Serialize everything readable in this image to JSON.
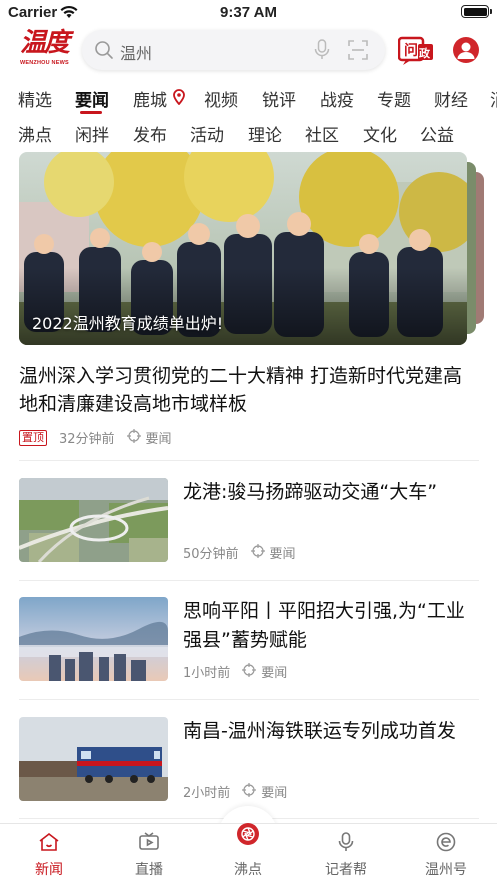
{
  "status_bar": {
    "carrier": "Carrier",
    "time": "9:37 AM",
    "battery_level": 1.0
  },
  "header": {
    "logo_text": "温度",
    "logo_subtext": "WENZHOU NEWS",
    "search_placeholder": "温州",
    "ask_label": "问政"
  },
  "channels_row1": [
    {
      "label": "精选",
      "active": false
    },
    {
      "label": "要闻",
      "active": true
    },
    {
      "label": "鹿城",
      "active": false
    },
    {
      "label": "视频",
      "active": false
    },
    {
      "label": "锐评",
      "active": false
    },
    {
      "label": "战疫",
      "active": false
    },
    {
      "label": "专题",
      "active": false
    },
    {
      "label": "财经",
      "active": false
    },
    {
      "label": "消",
      "active": false
    }
  ],
  "channels_row2": [
    {
      "label": "沸点"
    },
    {
      "label": "闲拌"
    },
    {
      "label": "发布"
    },
    {
      "label": "活动"
    },
    {
      "label": "理论"
    },
    {
      "label": "社区"
    },
    {
      "label": "文化"
    },
    {
      "label": "公益"
    }
  ],
  "hero": {
    "caption": "2022温州教育成绩单出炉!"
  },
  "top_article": {
    "title": "温州深入学习贯彻党的二十大精神 打造新时代党建高地和清廉建设高地市域样板",
    "badge": "置顶",
    "time": "32分钟前",
    "tag": "要闻"
  },
  "articles": [
    {
      "title": "龙港:骏马扬蹄驱动交通“大车”",
      "time": "50分钟前",
      "tag": "要闻",
      "thumb": "highway-interchange"
    },
    {
      "title": "思响平阳丨平阳招大引强,为“工业强县”蓄势赋能",
      "time": "1小时前",
      "tag": "要闻",
      "thumb": "misty-city"
    },
    {
      "title": "南昌-温州海铁联运专列成功首发",
      "time": "2小时前",
      "tag": "要闻",
      "thumb": "freight-train"
    }
  ],
  "tabbar": [
    {
      "label": "新闻",
      "icon": "home-icon",
      "active": true
    },
    {
      "label": "直播",
      "icon": "tv-icon",
      "active": false
    },
    {
      "label": "沸点",
      "icon": "aperture-icon",
      "active": false
    },
    {
      "label": "记者帮",
      "icon": "microphone-icon",
      "active": false
    },
    {
      "label": "温州号",
      "icon": "subscription-icon",
      "active": false
    }
  ],
  "colors": {
    "brand_red": "#c8161d",
    "meta_gray": "#888888"
  }
}
